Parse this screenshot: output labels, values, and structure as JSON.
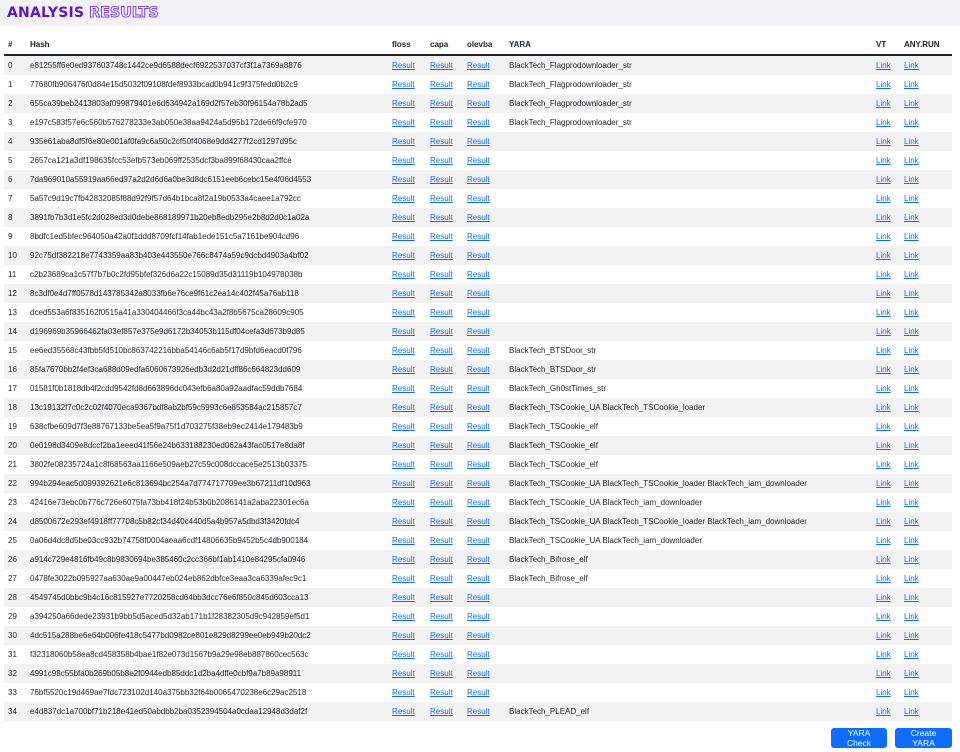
{
  "app": {
    "title_word1": "ANALYSIS",
    "title_word2": "RESULTS"
  },
  "table": {
    "headers": {
      "index": "#",
      "hash": "Hash",
      "floss": "floss",
      "capa": "capa",
      "olevba": "olevba",
      "yara": "YARA",
      "vt": "VT",
      "anyrun": "ANY.RUN"
    },
    "result_label": "Result",
    "link_label": "Link",
    "rows": [
      {
        "idx": "0",
        "hash": "e81255ff6e0ed937603748c1442ce9d6588decf6922537037cf3f1a7369a8876",
        "yara": "BlackTech_Flagprodownloader_str"
      },
      {
        "idx": "1",
        "hash": "77680fb906476f0d84e15d5032f09108fdef8933bcad0b941c9f375fedd0b2c9",
        "yara": "BlackTech_Flagprodownloader_str"
      },
      {
        "idx": "2",
        "hash": "655ca39beb2413803af099879401e6d634942a169d2f57eb30f96154a78b2ad5",
        "yara": "BlackTech_Flagprodownloader_str"
      },
      {
        "idx": "3",
        "hash": "e197c583f57e6c560b576278233e3ab050e38aa9424a5d95b172de66f9cfe970",
        "yara": "BlackTech_Flagprodownloader_str"
      },
      {
        "idx": "4",
        "hash": "935e61aba8df5f6e80e001af0fa9c6a50c2cf50f4068e9dd4277f2cd1297d95c",
        "yara": ""
      },
      {
        "idx": "5",
        "hash": "2657ca121a3df198635fcc53efb573eb069ff2535dcf3ba899f68430caa2ffce",
        "yara": ""
      },
      {
        "idx": "6",
        "hash": "7da969010a55919aa66ed97a2d2d6d6a0be3d8dc6151eeb6cebc15e4f06d4553",
        "yara": ""
      },
      {
        "idx": "7",
        "hash": "5a57c9d19c7fb42832085f88d92f9f57d64b1bca8f2a19b0533a4caee1a792cc",
        "yara": ""
      },
      {
        "idx": "8",
        "hash": "3891fb7b3d1e5fc2d028ed3d0debe868189971b20eb8edb295e2b8d2d0c1a02a",
        "yara": ""
      },
      {
        "idx": "9",
        "hash": "8bdfc1ed5bfec964050a42a0f1ddd8709fcf14fab1ede151c5a7161be904cd96",
        "yara": ""
      },
      {
        "idx": "10",
        "hash": "92c75df382218e7743359aa83b403e443550e766c8474a59c9dcbd4903a4bf02",
        "yara": ""
      },
      {
        "idx": "11",
        "hash": "c2b23689ca1c57f7b7b0c2fd95bfef326d6a22c15089d35d31119b104978038b",
        "yara": ""
      },
      {
        "idx": "12",
        "hash": "8c3df0e4d7ff0578d143785342a8033fb6e76ce9f61c2ea14c402f45a76ab118",
        "yara": ""
      },
      {
        "idx": "13",
        "hash": "dced553a6f835162f0515a41a330404466f3ca44bc43a2f8b5675ca28609c905",
        "yara": ""
      },
      {
        "idx": "14",
        "hash": "d196969b35966462fa03ef857e375e9d6172b34053b115df04cefa3d673b9d85",
        "yara": ""
      },
      {
        "idx": "15",
        "hash": "ee6ed35568c43fbb5fd510bc863742216bba54146c6ab5f17d9bfd6eacd0f796",
        "yara": "BlackTech_BTSDoor_str"
      },
      {
        "idx": "16",
        "hash": "85fa7670bb2f4ef3ca688d09edfa6060673926edb3d2d21dff86c664823dd609",
        "yara": "BlackTech_BTSDoor_str"
      },
      {
        "idx": "17",
        "hash": "01581f0b1818db4f2cdd9542fd8d663896dc043efb6a80a92aadfac59ddb7684",
        "yara": "BlackTech_Gh0stTimes_str"
      },
      {
        "idx": "18",
        "hash": "13c19132f7c0c2c02f4070eca9367bdf8ab2bf59c5993c6e853584ac215857c7",
        "yara": "BlackTech_TSCookie_UA BlackTech_TSCookie_loader"
      },
      {
        "idx": "19",
        "hash": "638cfbe609d7f3e88767133be5ea5f9a75f1d703275f38eb9ec2414e179483b9",
        "yara": "BlackTech_TSCookie_elf"
      },
      {
        "idx": "20",
        "hash": "0e0198d3409e8dccf2ba1eeed41f56e24b633188230ed062a43fac0517e8da8f",
        "yara": "BlackTech_TSCookie_elf"
      },
      {
        "idx": "21",
        "hash": "3802fe08235724a1c8f68563aa1166e509aeb27c59c008dccace5e2513b03375",
        "yara": "BlackTech_TSCookie_elf"
      },
      {
        "idx": "22",
        "hash": "994b294eac5d099392621e6c813694bc254a7d774717709ee3b67211df10d963",
        "yara": "BlackTech_TSCookie_UA BlackTech_TSCookie_loader BlackTech_iam_downloader"
      },
      {
        "idx": "23",
        "hash": "42416e73ebc0b776c726e6075fa73bb418f24b53b0b2086141a2aba22301ec6a",
        "yara": "BlackTech_TSCookie_UA BlackTech_iam_downloader"
      },
      {
        "idx": "24",
        "hash": "d8500672e293ef4918ff77708c5b82cf34d40c440d5a4b957a5dbd3f3420fdc4",
        "yara": "BlackTech_TSCookie_UA BlackTech_TSCookie_loader BlackTech_iam_downloader"
      },
      {
        "idx": "25",
        "hash": "0a06d4dc8d5be03cc932b74758f0004aeaa6cdf14806635b9452b5c4db900184",
        "yara": "BlackTech_TSCookie_UA BlackTech_iam_downloader"
      },
      {
        "idx": "26",
        "hash": "a914c729e4816fb49c8b9830694be385460c2cc366bf1ab1410e84295cfa0946",
        "yara": "BlackTech_Bifrose_elf"
      },
      {
        "idx": "27",
        "hash": "0478fe3022b095927aa630ae9a00447eb024eb862dbfce3eaa3ca6339afec9c1",
        "yara": "BlackTech_Bifrose_elf"
      },
      {
        "idx": "28",
        "hash": "4549745d0bbc9b4c16c815927e7720258cd64bb3dcc76e6f850c845d603cca13",
        "yara": ""
      },
      {
        "idx": "29",
        "hash": "a394250a66dede23931b9bb5d5aced5d32ab171b1f28382305d9c942859ef5d1",
        "yara": ""
      },
      {
        "idx": "30",
        "hash": "4dc515a288be6e64b006fe418c5477bd0982ce801e829d8299ee0eb949b20dc2",
        "yara": ""
      },
      {
        "idx": "31",
        "hash": "f32318060b58ea8cd458358b4bae1f82e073d1567b9a29e98eb887860cec563c",
        "yara": ""
      },
      {
        "idx": "32",
        "hash": "4991c98c55bfa0b269b05b8e2f0944edb85ddc1d2ba4dffe0cbf9a7b89a98911",
        "yara": ""
      },
      {
        "idx": "33",
        "hash": "76bf5520c19d469ae7fdc723102d140a375bb32f64b0065470238e6c29ac2518",
        "yara": ""
      },
      {
        "idx": "34",
        "hash": "e4d837dc1a700bf71b218e41ed50abdbb2ba0352394504a0cdaa12948d3daf2f",
        "yara": "BlackTech_PLEAD_elf"
      }
    ]
  },
  "buttons": {
    "yara_check": "YARA Check",
    "create_yara": "Create YARA"
  },
  "colors": {
    "brand_dark": "#5b16c9",
    "brand_outline": "#7b3ff2",
    "link": "#0d6efd",
    "button": "#0d6efd",
    "stripe": "#f2f2f2"
  }
}
